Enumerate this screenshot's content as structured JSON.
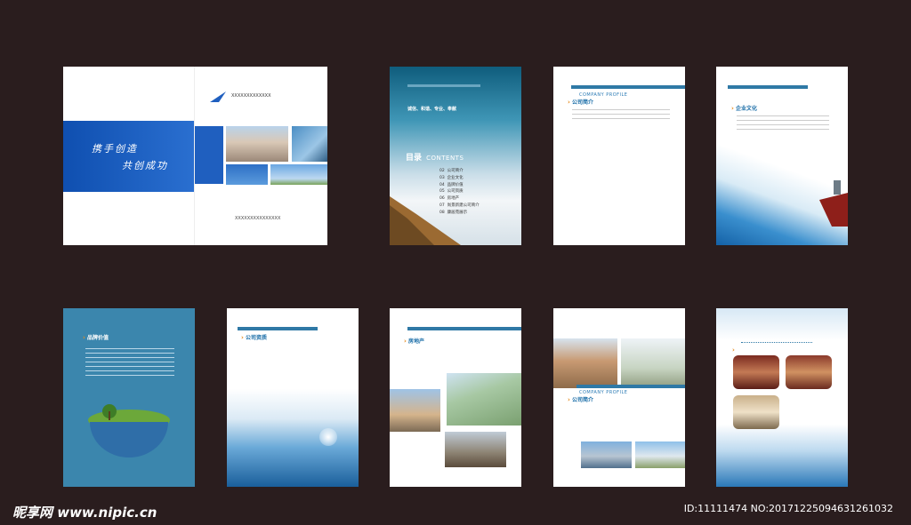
{
  "cover": {
    "slogan1": "携手创造",
    "slogan2": "共创成功",
    "logo_text": "XXXXXXXXXXXXX",
    "bottom_text": "XXXXXXXXXXXXXXX"
  },
  "toc": {
    "motto": "诚信、和谐、专业、奉献",
    "title_cn": "目录",
    "title_en": "CONTENTS",
    "items": [
      {
        "num": "02",
        "label": "公司简介"
      },
      {
        "num": "03",
        "label": "企业文化"
      },
      {
        "num": "04",
        "label": "品牌价值"
      },
      {
        "num": "05",
        "label": "公司资质"
      },
      {
        "num": "06",
        "label": "房地产"
      },
      {
        "num": "07",
        "label": "尚景新建公司简介"
      },
      {
        "num": "08",
        "label": "康居苑展示"
      }
    ]
  },
  "pages": {
    "profile_en": "COMPANY PROFILE",
    "profile_cn": "公司简介",
    "culture": "企业文化",
    "brand": "品牌价值",
    "qualification": "公司资质",
    "realestate": "房地产",
    "profile2_en": "COMPANY PROFILE",
    "profile2_cn": "公司简介"
  },
  "watermark": {
    "logo": "昵享网 www.nipic.cn",
    "id": "ID:11111474 NO:20171225094631261032"
  },
  "colors": {
    "background": "#2a1d1e",
    "accent": "#2f79a6",
    "cover_blue": "#1f5fbf",
    "arrow": "#e58a1e"
  }
}
